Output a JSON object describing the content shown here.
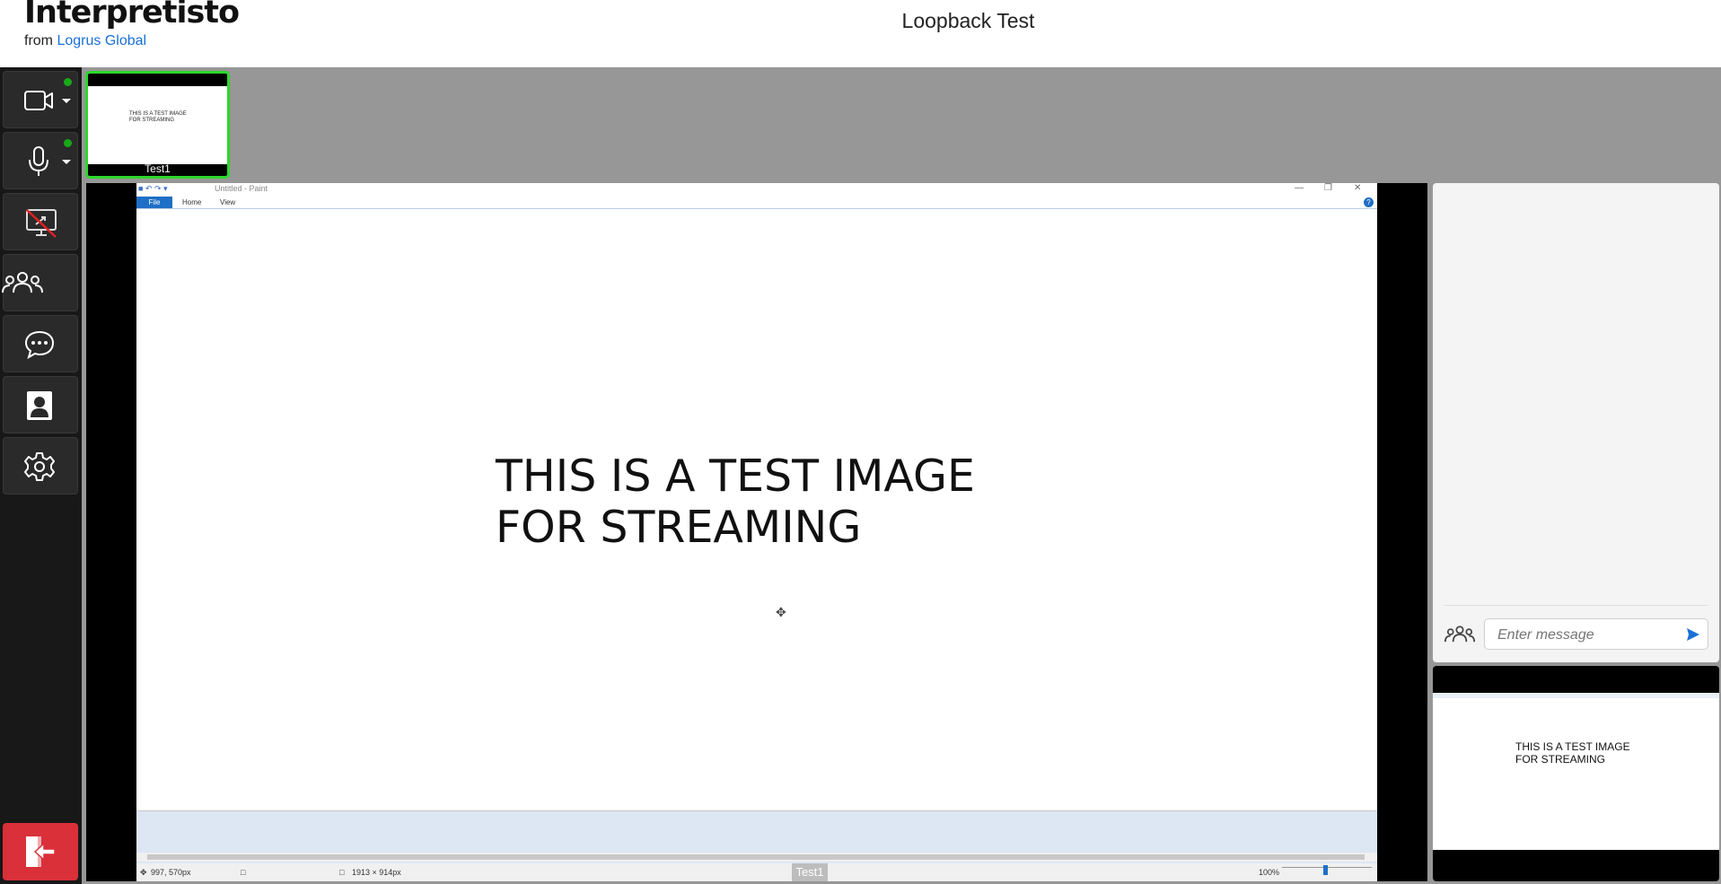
{
  "header": {
    "brand": "Interpretisto",
    "from_label": "from",
    "from_link": "Logrus Global",
    "title": "Loopback Test"
  },
  "sidebar": {
    "items": [
      {
        "name": "camera-button",
        "icon": "camera-icon",
        "status": "active"
      },
      {
        "name": "microphone-button",
        "icon": "microphone-icon",
        "status": "active"
      },
      {
        "name": "screen-share-button",
        "icon": "screen-share-off-icon"
      },
      {
        "name": "participants-button",
        "icon": "people-icon"
      },
      {
        "name": "chat-button",
        "icon": "chat-icon"
      },
      {
        "name": "profile-button",
        "icon": "contact-icon"
      },
      {
        "name": "settings-button",
        "icon": "gear-icon"
      }
    ],
    "exit_icon": "exit-icon",
    "colors": {
      "active_dot": "#18a818",
      "exit": "#d9303a"
    }
  },
  "thumbnail": {
    "label": "Test1",
    "screen_text_line1": "THIS IS A TEST IMAGE",
    "screen_text_line2": "FOR STREAMING",
    "border_color": "#2cd82c"
  },
  "paint": {
    "window_title": "Untitled - Paint",
    "menu": {
      "file": "File",
      "home": "Home",
      "view": "View"
    },
    "canvas_line1": "THIS IS A TEST IMAGE",
    "canvas_line2": "FOR STREAMING",
    "status": {
      "cursor_pos": "997, 570px",
      "image_size": "1913 × 914px",
      "zoom": "100%"
    },
    "stream_label": "Test1"
  },
  "chat": {
    "placeholder": "Enter message",
    "send_icon": "send-icon",
    "participants_icon": "people-icon"
  },
  "preview": {
    "line1": "THIS IS A TEST IMAGE",
    "line2": "FOR STREAMING"
  }
}
